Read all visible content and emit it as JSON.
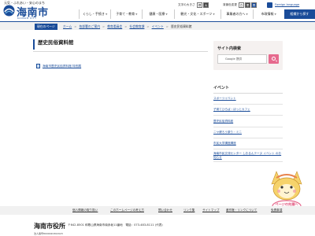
{
  "header": {
    "tagline": "元気・ふれあい・安心のまち",
    "logo_text": "海南市",
    "logo_sub": "KAINAN CITY",
    "text_size_label": "文字の大きさ",
    "text_size_options": [
      "標",
      "大"
    ],
    "bg_color_label": "背景色変更",
    "bg_color_options": [
      "白",
      "黒",
      "青"
    ],
    "language_link": "Foreign language"
  },
  "nav": {
    "items": [
      "くらし・手続き",
      "子育て・教育",
      "健康・医療",
      "観光・文化・スポーツ",
      "事業者の方へ",
      "市政情報",
      "組織から探す"
    ]
  },
  "breadcrumb": {
    "here_label": "現在のページ",
    "items": [
      "ホーム",
      "各部署のご案内",
      "教育委員会",
      "社会教育課",
      "イベント",
      "歴史民俗資料館"
    ]
  },
  "main": {
    "title": "歴史民俗資料館",
    "doc_link": "海南市歴史民俗資料館 特別展"
  },
  "sidebar": {
    "search_title": "サイト内検索",
    "search_placeholder": "Google 提供",
    "events_title": "イベント",
    "events": [
      "スポーツイベント",
      "子育てひろば・ほっとカフェ",
      "歴史民俗資料館",
      "ニヤ健ろう祭り・ミニ",
      "市民大学講座講座",
      "海南市民交流センター しおるんテーヌ イベント のお知らせ"
    ]
  },
  "mascot_label": "ページの先頭へ",
  "footer": {
    "links": [
      "個人情報の取り扱い",
      "このホームページの考え方",
      "問い合わせ",
      "リンク集",
      "サイトマップ",
      "著作権・リンクについて",
      "免責事項"
    ],
    "name": "海南市役所",
    "address": "〒642-8501 和歌山県海南市南赤坂11番地　電話：073-483-8111 (代表)",
    "corp_number": "法人番号8000020302023"
  }
}
